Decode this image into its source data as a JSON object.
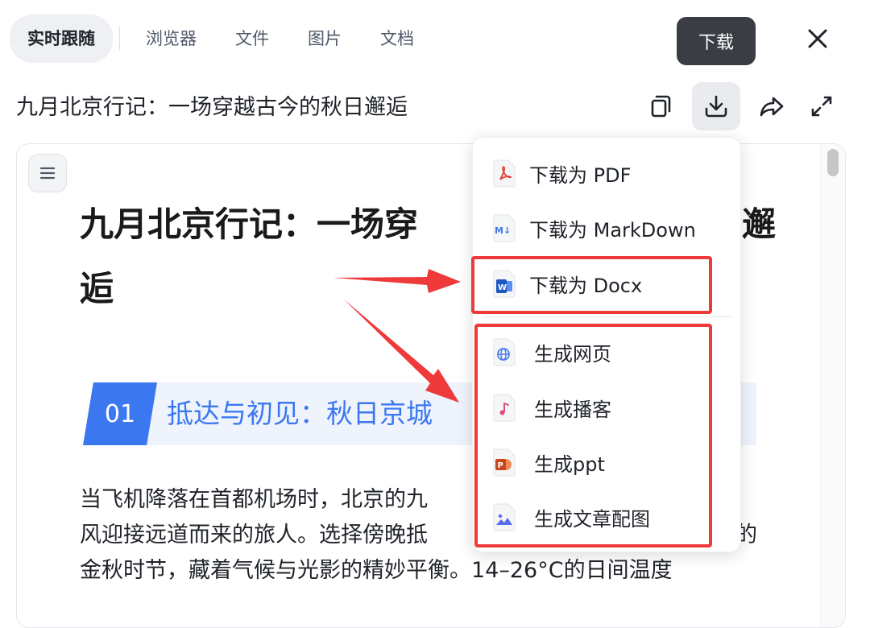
{
  "tabs": [
    {
      "label": "实时跟随"
    },
    {
      "label": "浏览器"
    },
    {
      "label": "文件"
    },
    {
      "label": "图片"
    },
    {
      "label": "文档"
    }
  ],
  "tooltip": {
    "text": "下载"
  },
  "document": {
    "title": "九月北京行记：一场穿越古今的秋日邂逅"
  },
  "article": {
    "heading_line1": "九月北京行记：一场穿",
    "heading_line1_tail": "邂",
    "heading_line2": "逅",
    "section": {
      "number": "01",
      "title": "抵达与初见：秋日京城"
    },
    "paragraph": {
      "line1": "当飞机降落在首都机场时，北京的九",
      "line2": "风迎接远道而来的旅人。选择傍晚抵",
      "line2_tail": "的",
      "line3": "金秋时节，藏着气候与光影的精妙平衡。14–26°C的日间温度"
    }
  },
  "download_menu": {
    "items": [
      {
        "label": "下载为 PDF",
        "icon": "pdf-file-icon"
      },
      {
        "label": "下载为 MarkDown",
        "icon": "markdown-file-icon"
      },
      {
        "label": "下载为 Docx",
        "icon": "word-file-icon"
      }
    ],
    "generate_items": [
      {
        "label": "生成网页",
        "icon": "globe-file-icon"
      },
      {
        "label": "生成播客",
        "icon": "music-note-file-icon"
      },
      {
        "label": "生成ppt",
        "icon": "powerpoint-file-icon"
      },
      {
        "label": "生成文章配图",
        "icon": "image-file-icon"
      }
    ]
  },
  "colors": {
    "accent": "#3b78f0",
    "annotation": "#ee3a3a",
    "tooltip_bg": "#3a3d44"
  }
}
